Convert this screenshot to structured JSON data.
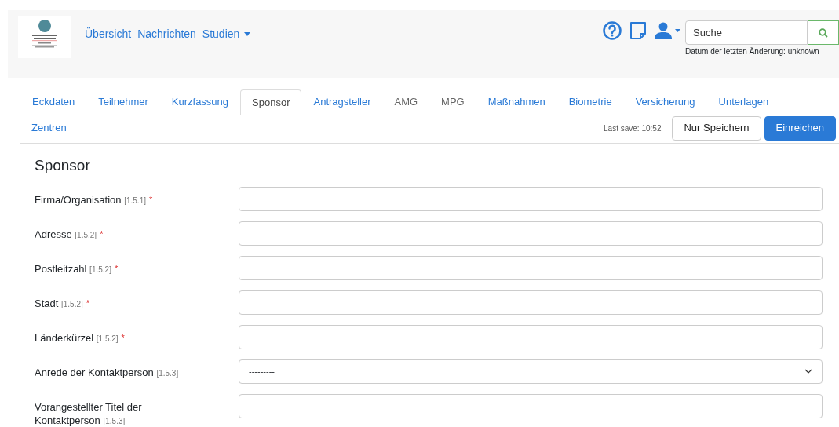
{
  "navbar": {
    "links": [
      {
        "label": "Übersicht",
        "dropdown": false
      },
      {
        "label": "Nachrichten",
        "dropdown": false
      },
      {
        "label": "Studien",
        "dropdown": true
      }
    ],
    "search": {
      "placeholder": "Suche"
    },
    "last_change": "Datum der letzten Änderung: unknown"
  },
  "tabs": [
    {
      "label": "Eckdaten",
      "selected": false,
      "disabled": false
    },
    {
      "label": "Teilnehmer",
      "selected": false,
      "disabled": false
    },
    {
      "label": "Kurzfassung",
      "selected": false,
      "disabled": false
    },
    {
      "label": "Sponsor",
      "selected": true,
      "disabled": false
    },
    {
      "label": "Antragsteller",
      "selected": false,
      "disabled": false
    },
    {
      "label": "AMG",
      "selected": false,
      "disabled": true
    },
    {
      "label": "MPG",
      "selected": false,
      "disabled": true
    },
    {
      "label": "Maßnahmen",
      "selected": false,
      "disabled": false
    },
    {
      "label": "Biometrie",
      "selected": false,
      "disabled": false
    },
    {
      "label": "Versicherung",
      "selected": false,
      "disabled": false
    },
    {
      "label": "Unterlagen",
      "selected": false,
      "disabled": false
    },
    {
      "label": "Zentren",
      "selected": false,
      "disabled": false
    }
  ],
  "last_save": "Last save: 10:52",
  "buttons": [
    {
      "label": "Nur Speichern",
      "kind": "secondary"
    },
    {
      "label": "Einreichen",
      "kind": "primary"
    }
  ],
  "section_title": "Sponsor",
  "fields": [
    {
      "label": "Firma/Organisation",
      "ref": "[1.5.1]",
      "required": "*",
      "kind": "text"
    },
    {
      "label": "Adresse",
      "ref": "[1.5.2]",
      "required": "*",
      "kind": "text"
    },
    {
      "label": "Postleitzahl",
      "ref": "[1.5.2]",
      "required": "*",
      "kind": "text"
    },
    {
      "label": "Stadt",
      "ref": "[1.5.2]",
      "required": "*",
      "kind": "text"
    },
    {
      "label": "Länderkürzel",
      "ref": "[1.5.2]",
      "required": "*",
      "kind": "text"
    },
    {
      "label": "Anrede der Kontaktperson",
      "ref": "[1.5.3]",
      "kind": "select",
      "value": "---------"
    },
    {
      "label": "Vorangestellter Titel der Kontaktperson",
      "ref": "[1.5.3]",
      "kind": "text"
    }
  ]
}
